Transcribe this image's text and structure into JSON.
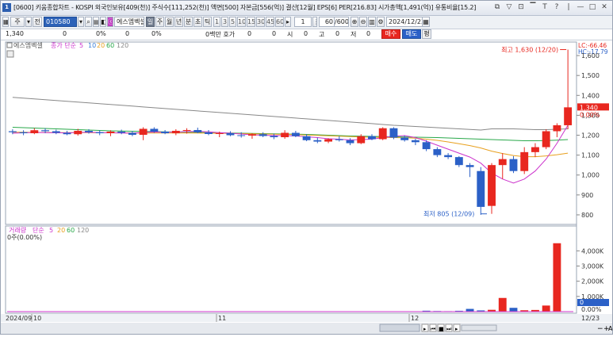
{
  "title": "[0600] 키움종합차트 - KOSPI 외국인보유[409(천)] 주식수[111,252(천)] 액면[500] 자본금[556(억)] 결산[12월] EPS[6] PER[216.83] 시가총액[1,491(억)] 유통비율[15.2]",
  "app_icon": "1",
  "window_buttons": [
    "⧉",
    "▽",
    "⊡",
    "▔",
    "T",
    "?",
    "|",
    "—",
    "□",
    "✕"
  ],
  "toolbar": {
    "mode_label": "주",
    "prev_label": "전",
    "code": "010580",
    "name": "에스엠벡셀",
    "buttons": [
      "일",
      "주",
      "월",
      "년",
      "분",
      "초",
      "틱"
    ],
    "minutes": [
      "1",
      "3",
      "5",
      "10",
      "15",
      "30",
      "45",
      "60"
    ],
    "count": "1",
    "view": "60",
    "total": "/600",
    "date": "2024/12/23"
  },
  "quote": {
    "price": "1,340",
    "change": "0",
    "pct": "0%",
    "vol": "0",
    "vol_pct": "0%",
    "unit_label": "0백만 호가",
    "bid": "0",
    "ask": "0",
    "open_label": "시",
    "open": "0",
    "high_label": "고",
    "high": "0",
    "low_label": "저",
    "low": "0",
    "buy_label": "매수",
    "sell_label": "매도",
    "eq_label": "평"
  },
  "price_panel": {
    "legend_name": "에스엠벡셀",
    "legend_ma": "종가 단순",
    "ma_periods": [
      "5",
      "10",
      "20",
      "60",
      "120"
    ],
    "ma_colors": [
      "#cc33cc",
      "#3a7ed8",
      "#e8a01e",
      "#29a84a",
      "#888888"
    ],
    "lc_label": "LC:-66.46",
    "hc_label": "HC:-17.79",
    "current_price": "1,340",
    "current_pct": "0.00%",
    "max_annotation": "최고 1,630 (12/20)",
    "min_annotation": "최저 805 (12/09)",
    "axis_ticks": [
      "1,600",
      "1,500",
      "1,400",
      "1,300",
      "1,200",
      "1,100",
      "1,000",
      "900",
      "800"
    ]
  },
  "volume_panel": {
    "legend_name": "거래량",
    "legend_ma": "단순",
    "ma_periods": [
      "5",
      "20",
      "60",
      "120"
    ],
    "sub_label": "0주(0.00%)",
    "axis_ticks": [
      "4,000K",
      "3,000K",
      "2,000K",
      "1,000K",
      "0.00%"
    ],
    "current_val": "0"
  },
  "xaxis": {
    "labels": [
      "2024/09",
      "10",
      "11",
      "12"
    ],
    "end_label": "12/23"
  },
  "colors": {
    "up": "#e8271f",
    "down": "#2b60c7",
    "accent": "#2d62b8"
  },
  "chart_data": {
    "type": "candlestick",
    "dates_note": "",
    "candles": [
      [
        1220,
        1230,
        1205,
        1215
      ],
      [
        1215,
        1225,
        1200,
        1210
      ],
      [
        1210,
        1235,
        1205,
        1225
      ],
      [
        1225,
        1235,
        1210,
        1220
      ],
      [
        1220,
        1228,
        1205,
        1212
      ],
      [
        1212,
        1222,
        1200,
        1205
      ],
      [
        1205,
        1232,
        1198,
        1222
      ],
      [
        1222,
        1230,
        1208,
        1215
      ],
      [
        1215,
        1225,
        1200,
        1210
      ],
      [
        1210,
        1225,
        1195,
        1218
      ],
      [
        1218,
        1228,
        1205,
        1212
      ],
      [
        1212,
        1222,
        1195,
        1202
      ],
      [
        1202,
        1240,
        1175,
        1232
      ],
      [
        1232,
        1240,
        1212,
        1218
      ],
      [
        1218,
        1226,
        1205,
        1210
      ],
      [
        1210,
        1230,
        1200,
        1222
      ],
      [
        1222,
        1235,
        1208,
        1226
      ],
      [
        1226,
        1238,
        1210,
        1214
      ],
      [
        1214,
        1226,
        1200,
        1206
      ],
      [
        1206,
        1218,
        1190,
        1210
      ],
      [
        1210,
        1220,
        1195,
        1200
      ],
      [
        1200,
        1215,
        1188,
        1198
      ],
      [
        1198,
        1210,
        1182,
        1205
      ],
      [
        1205,
        1215,
        1190,
        1196
      ],
      [
        1196,
        1208,
        1180,
        1190
      ],
      [
        1190,
        1225,
        1182,
        1212
      ],
      [
        1212,
        1222,
        1190,
        1195
      ],
      [
        1195,
        1205,
        1170,
        1175
      ],
      [
        1175,
        1188,
        1160,
        1168
      ],
      [
        1168,
        1185,
        1160,
        1180
      ],
      [
        1180,
        1195,
        1168,
        1175
      ],
      [
        1175,
        1185,
        1150,
        1160
      ],
      [
        1160,
        1205,
        1155,
        1195
      ],
      [
        1195,
        1205,
        1175,
        1180
      ],
      [
        1180,
        1240,
        1175,
        1235
      ],
      [
        1235,
        1240,
        1180,
        1188
      ],
      [
        1188,
        1198,
        1168,
        1175
      ],
      [
        1175,
        1182,
        1150,
        1165
      ],
      [
        1165,
        1175,
        1120,
        1130
      ],
      [
        1130,
        1140,
        1090,
        1100
      ],
      [
        1100,
        1110,
        1080,
        1090
      ],
      [
        1090,
        1095,
        1040,
        1050
      ],
      [
        1050,
        1060,
        990,
        1040
      ],
      [
        1020,
        1040,
        800,
        840
      ],
      [
        845,
        1060,
        805,
        1050
      ],
      [
        1050,
        1110,
        980,
        1080
      ],
      [
        1080,
        1095,
        1010,
        1020
      ],
      [
        1020,
        1140,
        1005,
        1115
      ],
      [
        1115,
        1160,
        1090,
        1140
      ],
      [
        1140,
        1230,
        1130,
        1220
      ],
      [
        1220,
        1260,
        1190,
        1250
      ],
      [
        1250,
        1630,
        1230,
        1340
      ]
    ],
    "volumes": [
      15,
      10,
      12,
      8,
      10,
      9,
      14,
      11,
      9,
      10,
      8,
      12,
      20,
      9,
      8,
      11,
      10,
      8,
      9,
      7,
      8,
      9,
      10,
      12,
      9,
      11,
      10,
      14,
      12,
      10,
      9,
      13,
      14,
      10,
      18,
      12,
      10,
      11,
      60,
      40,
      30,
      55,
      180,
      80,
      120,
      900,
      250,
      90,
      110,
      400,
      4500,
      0
    ],
    "ma_lines": {
      "ma5": [
        1210,
        1212,
        1214,
        1213,
        1212,
        1212,
        1214,
        1215,
        1213,
        1212,
        1211,
        1210,
        1214,
        1216,
        1215,
        1216,
        1218,
        1219,
        1217,
        1213,
        1210,
        1206,
        1202,
        1200,
        1198,
        1198,
        1196,
        1192,
        1188,
        1182,
        1180,
        1176,
        1178,
        1180,
        1188,
        1195,
        1198,
        1188,
        1170,
        1150,
        1130,
        1110,
        1090,
        1060,
        1010,
        980,
        960,
        980,
        1020,
        1080,
        1160,
        1250
      ],
      "ma20": [
        1215,
        1215,
        1214,
        1214,
        1213,
        1213,
        1213,
        1213,
        1212,
        1212,
        1212,
        1211,
        1211,
        1211,
        1211,
        1211,
        1211,
        1211,
        1210,
        1210,
        1209,
        1208,
        1207,
        1206,
        1205,
        1204,
        1203,
        1201,
        1199,
        1197,
        1195,
        1193,
        1191,
        1190,
        1189,
        1188,
        1187,
        1185,
        1180,
        1174,
        1166,
        1157,
        1148,
        1136,
        1120,
        1108,
        1098,
        1092,
        1092,
        1096,
        1102,
        1110
      ],
      "ma60": [
        1240,
        1238,
        1236,
        1234,
        1232,
        1230,
        1228,
        1226,
        1224,
        1222,
        1221,
        1220,
        1219,
        1218,
        1217,
        1216,
        1215,
        1214,
        1213,
        1212,
        1211,
        1210,
        1209,
        1208,
        1207,
        1206,
        1205,
        1204,
        1202,
        1200,
        1198,
        1196,
        1195,
        1194,
        1193,
        1192,
        1191,
        1190,
        1189,
        1188,
        1186,
        1184,
        1182,
        1180,
        1178,
        1176,
        1174,
        1172,
        1172,
        1173,
        1175,
        1178
      ],
      "ma120": [
        1390,
        1386,
        1382,
        1378,
        1374,
        1370,
        1366,
        1362,
        1358,
        1354,
        1350,
        1346,
        1342,
        1338,
        1334,
        1330,
        1326,
        1322,
        1318,
        1314,
        1310,
        1306,
        1302,
        1298,
        1294,
        1290,
        1286,
        1282,
        1278,
        1274,
        1270,
        1266,
        1262,
        1258,
        1254,
        1250,
        1247,
        1244,
        1241,
        1238,
        1235,
        1232,
        1229,
        1226,
        1232,
        1232,
        1232,
        1230,
        1228,
        1228,
        1230,
        1232
      ]
    },
    "ylim": [
      760,
      1660
    ],
    "vol_ylim": [
      0,
      4800
    ]
  }
}
